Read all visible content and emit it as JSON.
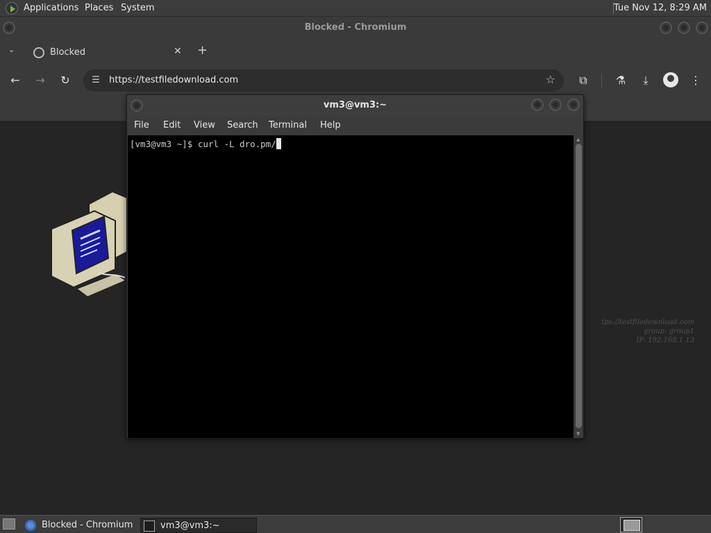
{
  "top_panel": {
    "menus": [
      "Applications",
      "Places",
      "System"
    ],
    "clock": "Tue Nov 12,  8:29 AM"
  },
  "chromium": {
    "window_title": "Blocked - Chromium",
    "tab_title": "Blocked",
    "url": "https://testfiledownload.com",
    "watermark": {
      "url_line": "tps://testfiledownload.com",
      "group_line": "group: group1",
      "ip_line": "IP: 192.168.1.13"
    }
  },
  "terminal": {
    "window_title": "vm3@vm3:~",
    "menus": [
      "File",
      "Edit",
      "View",
      "Search",
      "Terminal",
      "Help"
    ],
    "prompt_line": "[vm3@vm3 ~]$ curl -L dro.pm/"
  },
  "taskbar": {
    "tasks": [
      "Blocked - Chromium",
      "vm3@vm3:~"
    ]
  },
  "icons": {
    "back": "back-arrow-icon",
    "forward": "forward-arrow-icon",
    "reload": "reload-icon",
    "site_info": "tune-icon",
    "bookmark": "star-icon",
    "extensions": "puzzle-icon",
    "labs": "flask-icon",
    "downloads": "download-icon",
    "profile": "avatar-icon",
    "menu": "kebab-menu-icon"
  }
}
